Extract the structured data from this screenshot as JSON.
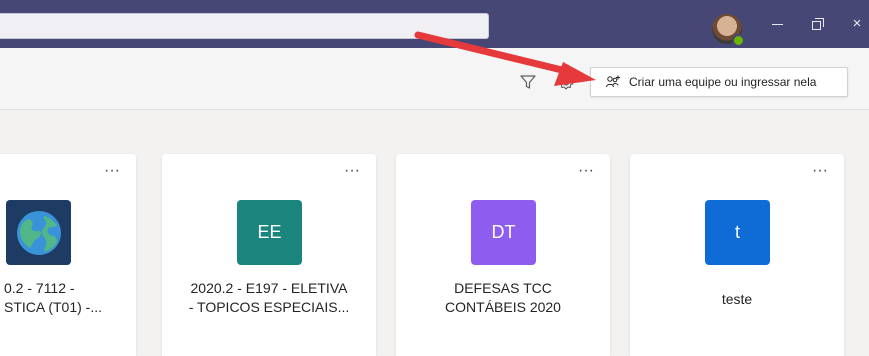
{
  "header": {
    "create_team_label": "Criar uma equipe ou ingressar nela",
    "icons": [
      "filter-icon",
      "gear-icon",
      "people-add-icon"
    ]
  },
  "titlebar": {
    "minimize": "—",
    "close": "×",
    "avatar_status": "available"
  },
  "teams": [
    {
      "line1": "0.2 - 7112 -",
      "line2": "STICA (T01) -...",
      "tile_icon": "earth-icon",
      "tile_color": "#1d3b63"
    },
    {
      "initials": "EE",
      "line1": "2020.2 - E197 - ELETIVA",
      "line2": "- TOPICOS ESPECIAIS...",
      "tile_color": "#1a857c"
    },
    {
      "initials": "DT",
      "line1": "DEFESAS TCC",
      "line2": "CONTÁBEIS 2020",
      "tile_color": "#8f5cf0"
    },
    {
      "initials": "t",
      "line1": "teste",
      "tile_color": "#0f6cd6"
    }
  ],
  "more_label": "···",
  "colors": {
    "titlebar": "#464775",
    "annotation_arrow": "#e5393b"
  }
}
